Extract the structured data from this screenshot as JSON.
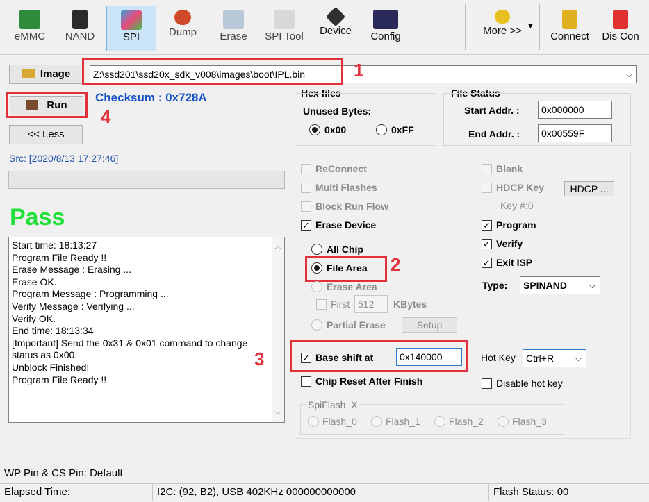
{
  "toolbar": {
    "emmc": "eMMC",
    "nand": "NAND",
    "spi": "SPI",
    "dump": "Dump",
    "erase": "Erase",
    "spi_tool": "SPI Tool",
    "device": "Device",
    "config": "Config",
    "more": "More >>",
    "connect": "Connect",
    "discon": "Dis Con"
  },
  "image": {
    "button": "Image",
    "path": "Z:\\ssd201\\ssd20x_sdk_v008\\images\\boot\\IPL.bin"
  },
  "run": {
    "label": "Run",
    "checksum": "Checksum : 0x728A"
  },
  "less": "<< Less",
  "src": "Src: [2020/8/13 17:27:46]",
  "result": "Pass",
  "log": [
    "Start time: 18:13:27",
    "Program File Ready !!",
    "Erase Message : Erasing ...",
    "Erase OK.",
    "Program Message : Programming ...",
    "Verify Message : Verifying ...",
    "Verify OK.",
    "End time: 18:13:34",
    "[Important] Send the 0x31 & 0x01 command to change",
    "status as 0x00.",
    "Unblock Finished!",
    "Program File Ready !!"
  ],
  "hex": {
    "title": "Hex files",
    "unused": "Unused Bytes:",
    "opt00": "0x00",
    "optff": "0xFF"
  },
  "file_status": {
    "title": "File Status",
    "start_label": "Start Addr. :",
    "start_value": "0x000000",
    "end_label": "End Addr. :",
    "end_value": "0x00559F"
  },
  "options": {
    "reconnect": "ReConnect",
    "multi": "Multi Flashes",
    "block": "Block Run Flow",
    "erase_device": "Erase Device",
    "all_chip": "All Chip",
    "file_area": "File Area",
    "erase_area": "Erase Area",
    "first": "First",
    "first_value": "512",
    "kbytes": "KBytes",
    "partial": "Partial Erase",
    "setup": "Setup",
    "blank": "Blank",
    "hdcp_key": "HDCP Key",
    "hdcp_btn": "HDCP ...",
    "key_no": "Key #:0",
    "program": "Program",
    "verify": "Verify",
    "exit_isp": "Exit ISP",
    "type_label": "Type:",
    "type_value": "SPINAND",
    "base_shift": "Base shift at",
    "base_value": "0x140000",
    "hotkey_label": "Hot Key",
    "hotkey_value": "Ctrl+R",
    "chip_reset": "Chip Reset After Finish",
    "disable_hotkey": "Disable hot key"
  },
  "spiflash": {
    "title": "SpiFlash_X",
    "f0": "Flash_0",
    "f1": "Flash_1",
    "f2": "Flash_2",
    "f3": "Flash_3"
  },
  "annotations": {
    "n1": "1",
    "n2": "2",
    "n3": "3",
    "n4": "4"
  },
  "status": {
    "wp": "WP Pin & CS Pin: Default",
    "elapsed": "Elapsed Time:",
    "i2c": "I2C: (92, B2), USB  402KHz  000000000000",
    "flash": "Flash Status: 00"
  },
  "colors": {
    "pass": "#22e03a",
    "checksum": "#1450c8",
    "annotation": "#e0303a"
  }
}
